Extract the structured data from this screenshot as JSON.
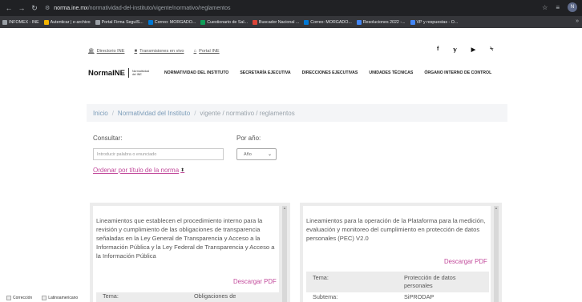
{
  "browser": {
    "url_host": "norma.ine.mx",
    "url_path": "/normatividad-del-instituto/vigente/normativo/reglamentos",
    "profile_initial": "N",
    "bookmarks": [
      {
        "label": "INFOMEX - INE",
        "color": "#9aa0a6"
      },
      {
        "label": "Autenticar | e-archivo",
        "color": "#f4b400"
      },
      {
        "label": "Portal Firma SeguIS...",
        "color": "#9aa0a6"
      },
      {
        "label": "Correo: MORGADO...",
        "color": "#0078d4"
      },
      {
        "label": "Cuestionario de Sal...",
        "color": "#0f9d58"
      },
      {
        "label": "Buscador Nacional ...",
        "color": "#db4437"
      },
      {
        "label": "Correo: MORGADO...",
        "color": "#0078d4"
      },
      {
        "label": "Resoluciones 2022 -...",
        "color": "#4285f4"
      },
      {
        "label": "VP y respuestas - O...",
        "color": "#4285f4"
      }
    ],
    "more": "»"
  },
  "utility": [
    {
      "label": "Directorio INE",
      "icon": "building-icon",
      "glyph": "🏛"
    },
    {
      "label": "Transmisiones en vivo",
      "icon": "video-icon",
      "glyph": "■"
    },
    {
      "label": "Portal INE",
      "icon": "home-icon",
      "glyph": "⌂"
    }
  ],
  "social": [
    "f",
    "𝕪",
    "▶",
    "⍀"
  ],
  "logo": {
    "main": "NormaINE",
    "sub": "Normatividad del INE"
  },
  "nav": [
    "NORMATIVIDAD DEL INSTITUTO",
    "SECRETARÍA EJECUTIVA",
    "DIRECCIONES EJECUTIVAS",
    "UNIDADES TÉCNICAS",
    "ÓRGANO INTERNO DE CONTROL"
  ],
  "breadcrumb": {
    "home": "Inicio",
    "section": "Normatividad del Instituto",
    "current": "vigente / normativo / reglamentos",
    "sep": "/"
  },
  "search": {
    "label": "Consultar:",
    "placeholder": "Introducir palabra o enunciado"
  },
  "year": {
    "label": "Por año:",
    "value": "Año"
  },
  "sort": {
    "label": "Ordenar por título de la norma"
  },
  "cards": [
    {
      "text": "Lineamientos que establecen el procedimiento interno para la revisión y cumplimiento de las obligaciones de transparencia señaladas en la Ley General de Transparencia y Acceso a la Información Pública y la Ley Federal de Transparencia y Acceso a la Información Pública",
      "download": "Descargar PDF",
      "rows": [
        {
          "key": "Tema:",
          "value": "Obligaciones de"
        }
      ]
    },
    {
      "text": "Lineamientos para la operación de la Plataforma para la medición, evaluación y monitoreo del cumplimiento en protección de datos personales (PEC) V2.0",
      "download": "Descargar PDF",
      "rows": [
        {
          "key": "Tema:",
          "value": "Protección de datos personales"
        },
        {
          "key": "Subtema:",
          "value": "SiPRODAP"
        }
      ]
    }
  ],
  "downloads": [
    "Corrección",
    "Latinoamericano"
  ]
}
